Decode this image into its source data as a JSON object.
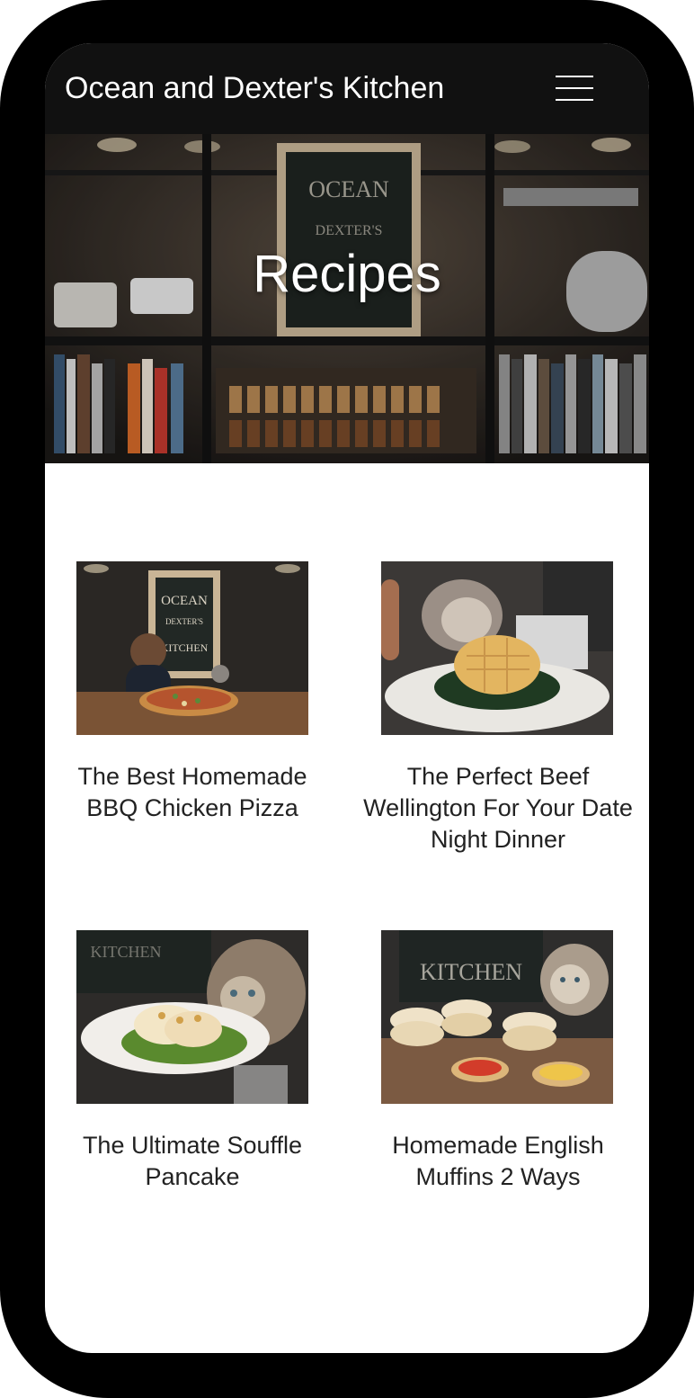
{
  "header": {
    "site_title": "Ocean and Dexter's Kitchen",
    "menu_icon": "hamburger-menu-icon"
  },
  "hero": {
    "title": "Recipes",
    "image": "kitchen shelves with Ocean & Dexter's chalkboard sign"
  },
  "recipes": [
    {
      "title": "The Best Homemade BBQ Chicken Pizza",
      "image": "pizza on cutting board with chef and cat"
    },
    {
      "title": "The Perfect Beef Wellington For Your Date Night Dinner",
      "image": "waffle on greens with cat"
    },
    {
      "title": "The Ultimate Souffle Pancake",
      "image": "souffle pancake plate with cat"
    },
    {
      "title": "Homemade English Muffins 2 Ways",
      "image": "stack of english muffins with cat"
    }
  ],
  "colors": {
    "frame": "#000000",
    "header_bg": "#111111",
    "text": "#222222",
    "hero_text": "#ffffff"
  }
}
